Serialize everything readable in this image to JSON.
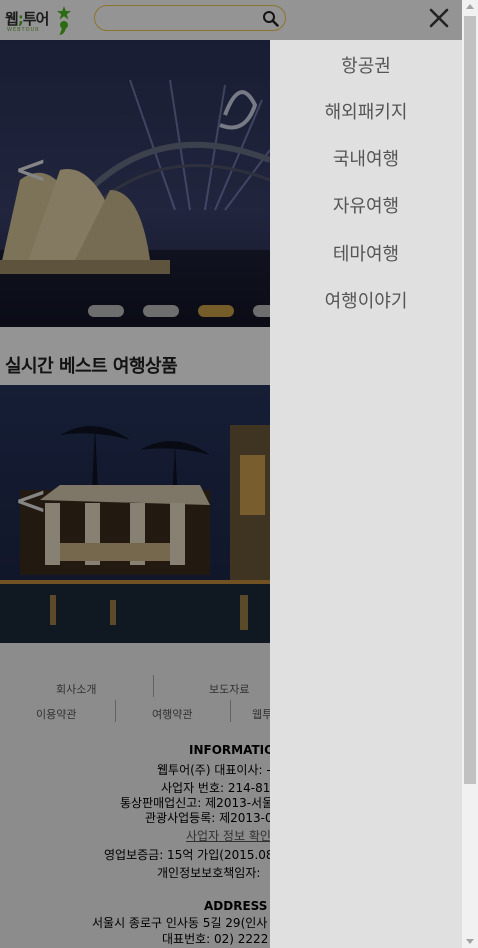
{
  "logo": {
    "text": "웹;투어",
    "subtitle": "WEBTOUR"
  },
  "search": {
    "placeholder": ""
  },
  "banner": {
    "prev_label": "<",
    "dots_active_index": 2,
    "dots_count": 4
  },
  "best": {
    "title": "실시간 베스트 여행상품",
    "prev_label": "<"
  },
  "footer": {
    "links_row1": [
      "회사소개",
      "보도자료"
    ],
    "links_row2": [
      "이용약관",
      "여행약관",
      "웹투"
    ],
    "info_heading": "INFORMATION",
    "info_lines": [
      "웹투어(주) 대표이사: -",
      "사업자 번호: 214-81-",
      "통상판매업신고: 제2013-서울",
      "관광사업등록: 제2013-0",
      "사업자 정보 확인",
      "영업보증금: 15억 가입(2015.08.",
      "개인정보보호책임자:"
    ],
    "address_heading": "ADDRESS",
    "address_lines": [
      "서울시 종로구 인사동 5길 29(인사",
      "대표번호: 02) 2222 -"
    ]
  },
  "side_menu": {
    "items": [
      "항공권",
      "해외패키지",
      "국내여행",
      "자유여행",
      "테마여행",
      "여행이야기"
    ]
  },
  "colors": {
    "brand_green": "#4cb821",
    "search_border": "#f2c94c",
    "dot_active": "#c9a148",
    "menu_bg": "#e0e0e0"
  }
}
